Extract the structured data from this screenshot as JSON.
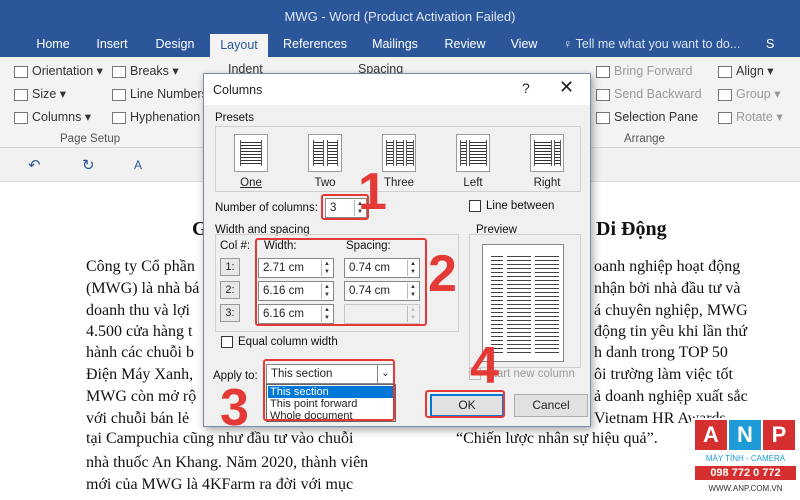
{
  "window": {
    "title": "MWG - Word (Product Activation Failed)"
  },
  "tabs": [
    "Home",
    "Insert",
    "Design",
    "Layout",
    "References",
    "Mailings",
    "Review",
    "View"
  ],
  "tell_me": "Tell me what you want to do...",
  "share": "S",
  "ribbon": {
    "orientation": "Orientation",
    "size": "Size",
    "columns": "Columns",
    "breaks": "Breaks",
    "line_numbers": "Line Numbers",
    "hyphenation": "Hyphenation",
    "page_setup": "Page Setup",
    "indent": "Indent",
    "spacing": "Spacing",
    "bring_forward": "Bring Forward",
    "send_backward": "Send Backward",
    "selection_pane": "Selection Pane",
    "align": "Align",
    "group": "Group",
    "rotate": "Rotate",
    "arrange": "Arrange"
  },
  "document": {
    "heading_left": "G",
    "heading_right": "Di Động",
    "left_lines": [
      "Công ty Cổ phần",
      "(MWG) là nhà bá",
      "doanh thu và lợi",
      "4.500 cửa hàng t",
      "hành các chuỗi b",
      "Điện Máy Xanh,",
      "MWG còn mở rộ",
      "với chuỗi bán lẻ",
      "tại Campuchia cũng như đầu tư vào chuỗi",
      "nhà thuốc An Khang. Năm 2020, thành viên",
      "mới của MWG là 4KFarm ra đời với mục"
    ],
    "right_lines": [
      "oanh nghiệp hoạt động",
      "nhận bởi nhà đầu tư và",
      "á chuyên nghiệp, MWG",
      "động tin yêu khi lần thứ",
      "h danh trong TOP 50",
      "ôi trường làm việc tốt",
      "ả doanh nghiệp xuất sắc",
      "Vietnam HR Awards –",
      "“Chiến lược nhân sự hiệu quả”."
    ]
  },
  "dialog": {
    "title": "Columns",
    "help": "?",
    "close": "✕",
    "presets_label": "Presets",
    "presets": [
      "One",
      "Two",
      "Three",
      "Left",
      "Right"
    ],
    "number_of_columns_label": "Number of columns:",
    "number_of_columns": "3",
    "line_between": "Line between",
    "width_spacing_label": "Width and spacing",
    "col_header": "Col #:",
    "width_header": "Width:",
    "spacing_header": "Spacing:",
    "rows": [
      {
        "col": "1:",
        "width": "2.71 cm",
        "spacing": "0.74 cm"
      },
      {
        "col": "2:",
        "width": "6.16 cm",
        "spacing": "0.74 cm"
      },
      {
        "col": "3:",
        "width": "6.16 cm",
        "spacing": ""
      }
    ],
    "equal_width": "Equal column width",
    "preview_label": "Preview",
    "apply_to_label": "Apply to:",
    "apply_to_value": "This section",
    "apply_options": [
      "This section",
      "This point forward",
      "Whole document"
    ],
    "start_new_column": "Start new column",
    "ok": "OK",
    "cancel": "Cancel"
  },
  "annotations": [
    "1",
    "2",
    "3",
    "4"
  ],
  "logo": {
    "text": "ANP",
    "sub": "MÁY TÍNH - CAMERA",
    "phone": "098 772 0 772",
    "url": "WWW.ANP.COM.VN"
  }
}
